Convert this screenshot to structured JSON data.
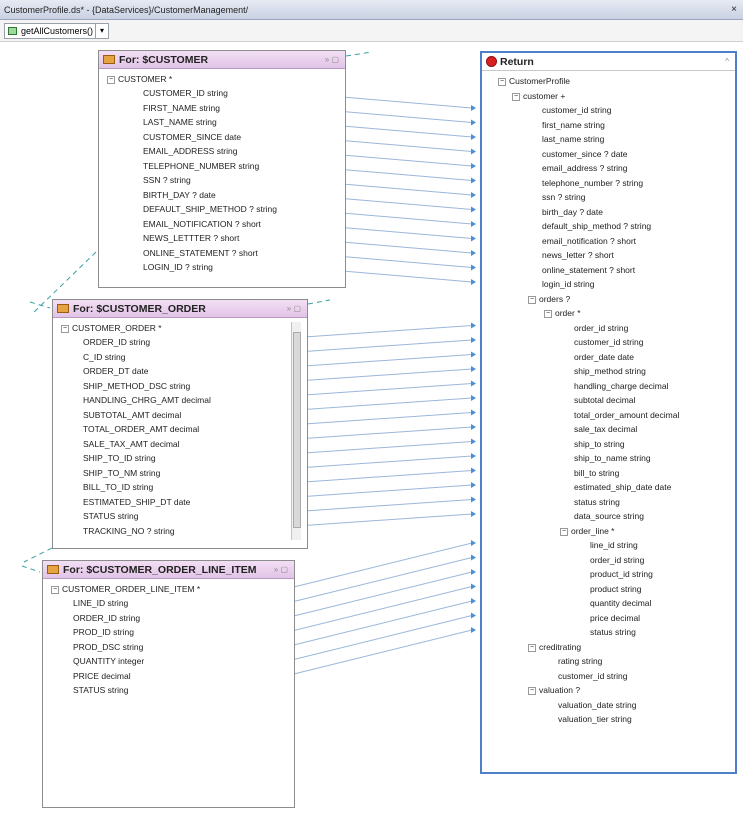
{
  "window": {
    "title": "CustomerProfile.ds* - {DataServices}/CustomerManagement/",
    "close": "×"
  },
  "toolbar": {
    "function_label": "getAllCustomers()",
    "dropdown": "▾"
  },
  "customer": {
    "title": "For: $CUSTOMER",
    "root": "CUSTOMER *",
    "fields": [
      "CUSTOMER_ID string",
      "FIRST_NAME string",
      "LAST_NAME string",
      "CUSTOMER_SINCE date",
      "EMAIL_ADDRESS string",
      "TELEPHONE_NUMBER string",
      "SSN ? string",
      "BIRTH_DAY ? date",
      "DEFAULT_SHIP_METHOD ? string",
      "EMAIL_NOTIFICATION ? short",
      "NEWS_LETTTER ? short",
      "ONLINE_STATEMENT ? short",
      "LOGIN_ID ? string"
    ]
  },
  "order": {
    "title": "For: $CUSTOMER_ORDER",
    "root": "CUSTOMER_ORDER *",
    "fields": [
      "ORDER_ID string",
      "C_ID string",
      "ORDER_DT date",
      "SHIP_METHOD_DSC string",
      "HANDLING_CHRG_AMT decimal",
      "SUBTOTAL_AMT decimal",
      "TOTAL_ORDER_AMT decimal",
      "SALE_TAX_AMT decimal",
      "SHIP_TO_ID string",
      "SHIP_TO_NM string",
      "BILL_TO_ID string",
      "ESTIMATED_SHIP_DT date",
      "STATUS string",
      "TRACKING_NO ? string"
    ]
  },
  "line_item": {
    "title": "For: $CUSTOMER_ORDER_LINE_ITEM",
    "root": "CUSTOMER_ORDER_LINE_ITEM *",
    "fields": [
      "LINE_ID string",
      "ORDER_ID string",
      "PROD_ID string",
      "PROD_DSC string",
      "QUANTITY integer",
      "PRICE decimal",
      "STATUS string"
    ]
  },
  "ret": {
    "title": "Return",
    "profile": "CustomerProfile",
    "customer": "customer +",
    "customer_fields": [
      "customer_id string",
      "first_name string",
      "last_name string",
      "customer_since ? date",
      "email_address ? string",
      "telephone_number ? string",
      "ssn ? string",
      "birth_day ? date",
      "default_ship_method ? string",
      "email_notification ? short",
      "news_letter ? short",
      "online_statement ? short",
      "login_id string"
    ],
    "orders": "orders ?",
    "order": "order *",
    "order_fields": [
      "order_id string",
      "customer_id string",
      "order_date date",
      "ship_method string",
      "handling_charge decimal",
      "subtotal decimal",
      "total_order_amount decimal",
      "sale_tax decimal",
      "ship_to string",
      "ship_to_name string",
      "bill_to string",
      "estimated_ship_date date",
      "status string",
      "data_source string"
    ],
    "order_line": "order_line *",
    "line_fields": [
      "line_id string",
      "order_id string",
      "product_id string",
      "product string",
      "quantity decimal",
      "price decimal",
      "status string"
    ],
    "creditrating": "creditrating",
    "credit_fields": [
      "rating string",
      "customer_id string"
    ],
    "valuation": "valuation ?",
    "valuation_fields": [
      "valuation_date string",
      "valuation_tier string"
    ]
  },
  "colors": {
    "header": "#e1c4e6",
    "return_border": "#4f7fc9",
    "mapping_line": "#9bb7d9",
    "link_arrow": "#3aa0a0"
  }
}
